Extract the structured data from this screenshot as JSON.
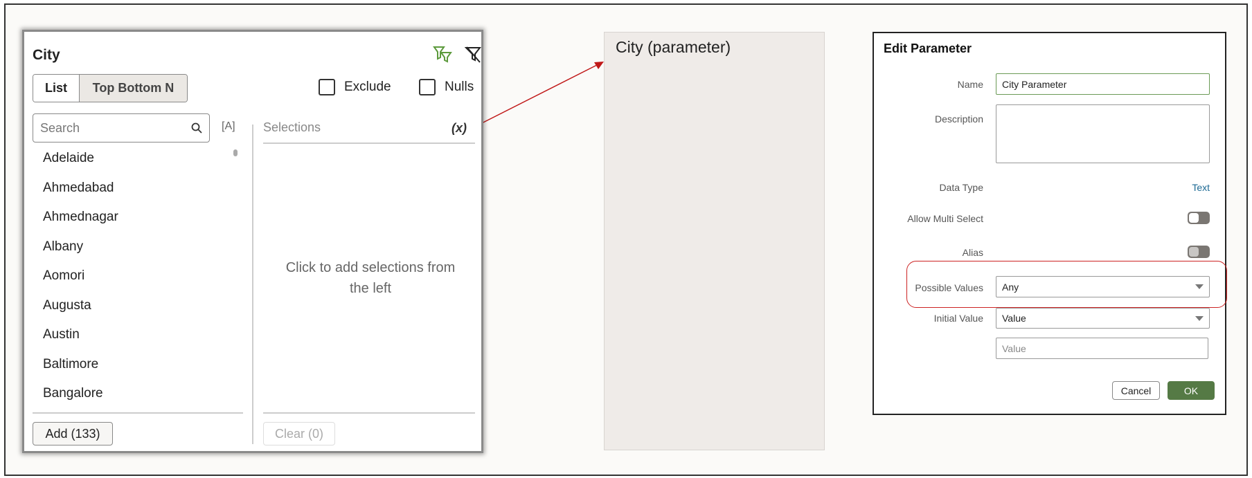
{
  "filter_panel": {
    "title": "City",
    "tabs": [
      "List",
      "Top Bottom N"
    ],
    "exclude_label": "Exclude",
    "nulls_label": "Nulls",
    "search_placeholder": "Search",
    "case_icon_label": "[A]",
    "selections_label": "Selections",
    "expression_label": "(x)",
    "items": [
      "Adelaide",
      "Ahmedabad",
      "Ahmednagar",
      "Albany",
      "Aomori",
      "Augusta",
      "Austin",
      "Baltimore",
      "Bangalore"
    ],
    "empty_message": "Click to add selections from the left",
    "add_label": "Add (133)",
    "clear_label": "Clear (0)",
    "accent_color": "#5c9a3c"
  },
  "parameter_panel": {
    "title": "City (parameter)"
  },
  "dialog": {
    "title": "Edit Parameter",
    "name_label": "Name",
    "name_value": "City Parameter",
    "description_label": "Description",
    "description_value": "",
    "data_type_label": "Data Type",
    "data_type_value": "Text",
    "multi_select_label": "Allow Multi Select",
    "multi_select_on": false,
    "alias_label": "Alias",
    "alias_on": false,
    "possible_values_label": "Possible Values",
    "possible_values_value": "Any",
    "initial_value_label": "Initial Value",
    "initial_value_value": "Value",
    "value_placeholder": "Value",
    "cancel_label": "Cancel",
    "ok_label": "OK",
    "ok_color": "#557a45",
    "highlight_color": "#cc2222"
  }
}
